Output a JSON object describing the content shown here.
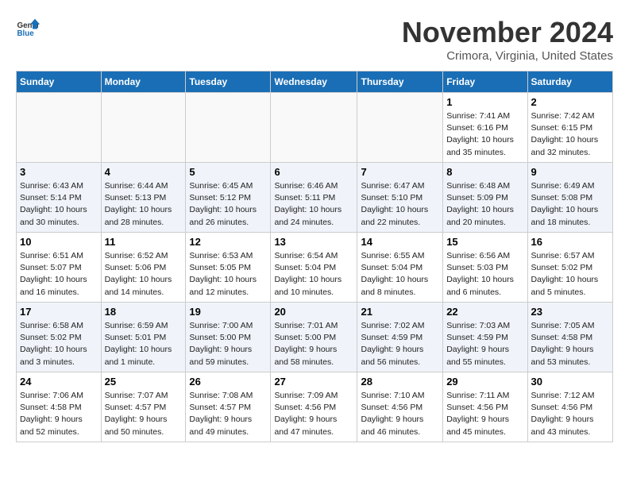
{
  "header": {
    "logo_general": "General",
    "logo_blue": "Blue",
    "title": "November 2024",
    "location": "Crimora, Virginia, United States"
  },
  "weekdays": [
    "Sunday",
    "Monday",
    "Tuesday",
    "Wednesday",
    "Thursday",
    "Friday",
    "Saturday"
  ],
  "weeks": [
    [
      {
        "day": "",
        "info": ""
      },
      {
        "day": "",
        "info": ""
      },
      {
        "day": "",
        "info": ""
      },
      {
        "day": "",
        "info": ""
      },
      {
        "day": "",
        "info": ""
      },
      {
        "day": "1",
        "info": "Sunrise: 7:41 AM\nSunset: 6:16 PM\nDaylight: 10 hours\nand 35 minutes."
      },
      {
        "day": "2",
        "info": "Sunrise: 7:42 AM\nSunset: 6:15 PM\nDaylight: 10 hours\nand 32 minutes."
      }
    ],
    [
      {
        "day": "3",
        "info": "Sunrise: 6:43 AM\nSunset: 5:14 PM\nDaylight: 10 hours\nand 30 minutes."
      },
      {
        "day": "4",
        "info": "Sunrise: 6:44 AM\nSunset: 5:13 PM\nDaylight: 10 hours\nand 28 minutes."
      },
      {
        "day": "5",
        "info": "Sunrise: 6:45 AM\nSunset: 5:12 PM\nDaylight: 10 hours\nand 26 minutes."
      },
      {
        "day": "6",
        "info": "Sunrise: 6:46 AM\nSunset: 5:11 PM\nDaylight: 10 hours\nand 24 minutes."
      },
      {
        "day": "7",
        "info": "Sunrise: 6:47 AM\nSunset: 5:10 PM\nDaylight: 10 hours\nand 22 minutes."
      },
      {
        "day": "8",
        "info": "Sunrise: 6:48 AM\nSunset: 5:09 PM\nDaylight: 10 hours\nand 20 minutes."
      },
      {
        "day": "9",
        "info": "Sunrise: 6:49 AM\nSunset: 5:08 PM\nDaylight: 10 hours\nand 18 minutes."
      }
    ],
    [
      {
        "day": "10",
        "info": "Sunrise: 6:51 AM\nSunset: 5:07 PM\nDaylight: 10 hours\nand 16 minutes."
      },
      {
        "day": "11",
        "info": "Sunrise: 6:52 AM\nSunset: 5:06 PM\nDaylight: 10 hours\nand 14 minutes."
      },
      {
        "day": "12",
        "info": "Sunrise: 6:53 AM\nSunset: 5:05 PM\nDaylight: 10 hours\nand 12 minutes."
      },
      {
        "day": "13",
        "info": "Sunrise: 6:54 AM\nSunset: 5:04 PM\nDaylight: 10 hours\nand 10 minutes."
      },
      {
        "day": "14",
        "info": "Sunrise: 6:55 AM\nSunset: 5:04 PM\nDaylight: 10 hours\nand 8 minutes."
      },
      {
        "day": "15",
        "info": "Sunrise: 6:56 AM\nSunset: 5:03 PM\nDaylight: 10 hours\nand 6 minutes."
      },
      {
        "day": "16",
        "info": "Sunrise: 6:57 AM\nSunset: 5:02 PM\nDaylight: 10 hours\nand 5 minutes."
      }
    ],
    [
      {
        "day": "17",
        "info": "Sunrise: 6:58 AM\nSunset: 5:02 PM\nDaylight: 10 hours\nand 3 minutes."
      },
      {
        "day": "18",
        "info": "Sunrise: 6:59 AM\nSunset: 5:01 PM\nDaylight: 10 hours\nand 1 minute."
      },
      {
        "day": "19",
        "info": "Sunrise: 7:00 AM\nSunset: 5:00 PM\nDaylight: 9 hours\nand 59 minutes."
      },
      {
        "day": "20",
        "info": "Sunrise: 7:01 AM\nSunset: 5:00 PM\nDaylight: 9 hours\nand 58 minutes."
      },
      {
        "day": "21",
        "info": "Sunrise: 7:02 AM\nSunset: 4:59 PM\nDaylight: 9 hours\nand 56 minutes."
      },
      {
        "day": "22",
        "info": "Sunrise: 7:03 AM\nSunset: 4:59 PM\nDaylight: 9 hours\nand 55 minutes."
      },
      {
        "day": "23",
        "info": "Sunrise: 7:05 AM\nSunset: 4:58 PM\nDaylight: 9 hours\nand 53 minutes."
      }
    ],
    [
      {
        "day": "24",
        "info": "Sunrise: 7:06 AM\nSunset: 4:58 PM\nDaylight: 9 hours\nand 52 minutes."
      },
      {
        "day": "25",
        "info": "Sunrise: 7:07 AM\nSunset: 4:57 PM\nDaylight: 9 hours\nand 50 minutes."
      },
      {
        "day": "26",
        "info": "Sunrise: 7:08 AM\nSunset: 4:57 PM\nDaylight: 9 hours\nand 49 minutes."
      },
      {
        "day": "27",
        "info": "Sunrise: 7:09 AM\nSunset: 4:56 PM\nDaylight: 9 hours\nand 47 minutes."
      },
      {
        "day": "28",
        "info": "Sunrise: 7:10 AM\nSunset: 4:56 PM\nDaylight: 9 hours\nand 46 minutes."
      },
      {
        "day": "29",
        "info": "Sunrise: 7:11 AM\nSunset: 4:56 PM\nDaylight: 9 hours\nand 45 minutes."
      },
      {
        "day": "30",
        "info": "Sunrise: 7:12 AM\nSunset: 4:56 PM\nDaylight: 9 hours\nand 43 minutes."
      }
    ]
  ]
}
